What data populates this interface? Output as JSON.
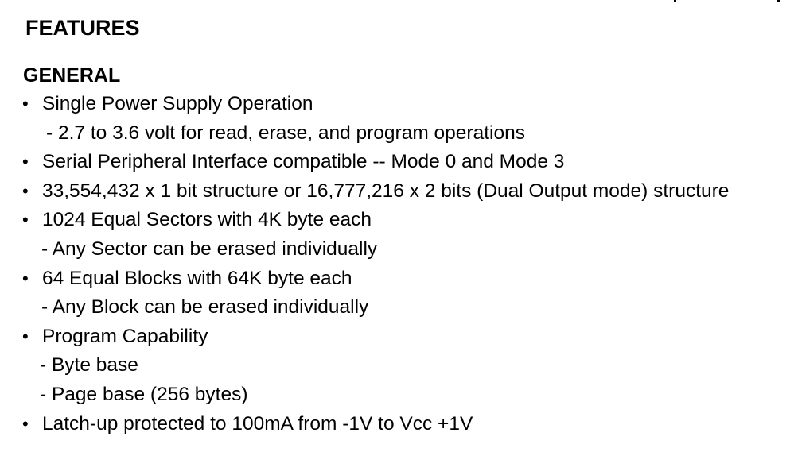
{
  "section": {
    "title": "FEATURES",
    "subtitle": "GENERAL"
  },
  "lines": [
    {
      "kind": "bullet",
      "text": "Single Power Supply Operation"
    },
    {
      "kind": "sub",
      "text": "- 2.7 to 3.6 volt for read, erase, and program operations"
    },
    {
      "kind": "bullet",
      "text": "Serial Peripheral Interface compatible -- Mode 0 and Mode 3"
    },
    {
      "kind": "bullet",
      "text": "33,554,432 x 1 bit structure or 16,777,216 x 2 bits (Dual Output mode) structure"
    },
    {
      "kind": "bullet",
      "text": "1024 Equal Sectors with 4K byte each"
    },
    {
      "kind": "sub",
      "text": "- Any Sector can be erased individually"
    },
    {
      "kind": "bullet",
      "text": "64 Equal Blocks with 64K byte each"
    },
    {
      "kind": "sub",
      "text": "- Any Block can be erased individually"
    },
    {
      "kind": "bullet",
      "text": "Program Capability"
    },
    {
      "kind": "sub",
      "text": "- Byte base"
    },
    {
      "kind": "sub",
      "text": "- Page base (256 bytes)"
    },
    {
      "kind": "bullet",
      "text": "Latch-up protected to 100mA from -1V to Vcc +1V"
    }
  ],
  "bullet_symbol": "•"
}
